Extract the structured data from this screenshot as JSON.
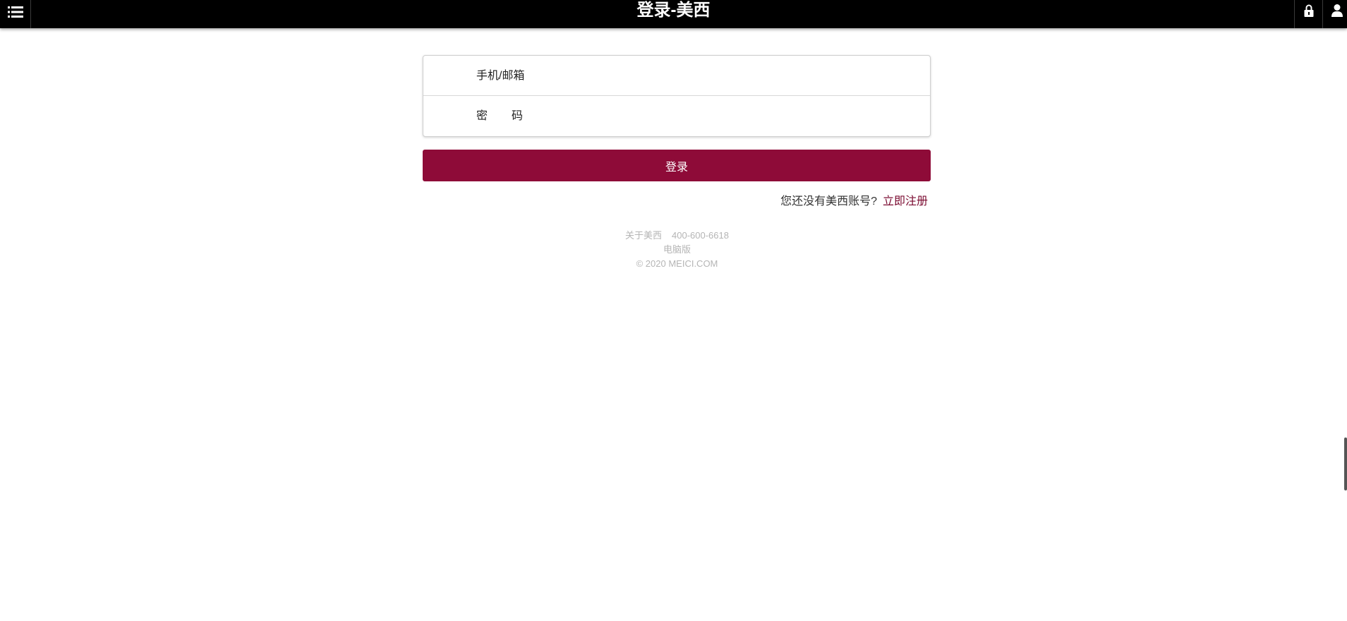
{
  "header": {
    "title": "登录-美西",
    "menu_icon": "list-icon",
    "lock_icon": "lock-icon",
    "user_icon": "user-icon"
  },
  "login_form": {
    "account_label": "手机/邮箱",
    "account_value": "",
    "password_label": "密码",
    "password_value": "",
    "submit_label": "登录"
  },
  "register": {
    "prompt": "您还没有美西账号?",
    "link_label": "立即注册"
  },
  "footer": {
    "about": "关于美西",
    "phone": "400-600-6618",
    "desktop": "电脑版",
    "copyright": "© 2020 MEICI.COM"
  },
  "colors": {
    "brand": "#8e0b38",
    "topbar": "#000000",
    "footer_text": "#b5b5b5"
  }
}
